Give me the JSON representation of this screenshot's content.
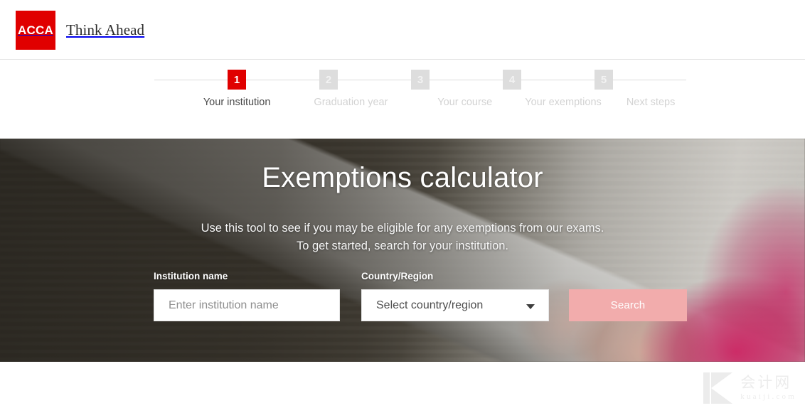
{
  "header": {
    "logo_text": "ACCA",
    "logo_color": "#e00000",
    "tagline": "Think Ahead"
  },
  "stepper": {
    "active_index": 0,
    "active_color": "#e00000",
    "inactive_color": "#dddddd",
    "steps": [
      {
        "number": "1",
        "label": "Your institution"
      },
      {
        "number": "2",
        "label": "Graduation year"
      },
      {
        "number": "3",
        "label": "Your course"
      },
      {
        "number": "4",
        "label": "Your exemptions"
      },
      {
        "number": "5",
        "label": "Next steps"
      }
    ]
  },
  "hero": {
    "title": "Exemptions calculator",
    "subtitle_line1": "Use this tool to see if you may be eligible for any exemptions from our exams.",
    "subtitle_line2": "To get started, search for your institution."
  },
  "form": {
    "institution": {
      "label": "Institution name",
      "value": "",
      "placeholder": "Enter institution name"
    },
    "country": {
      "label": "Country/Region",
      "selected": "Select country/region"
    },
    "search_button": {
      "label": "Search",
      "color": "#f2acac"
    }
  },
  "watermark": {
    "logo_letter": "K",
    "chinese": "会计网",
    "domain": "kuaiji.com"
  }
}
